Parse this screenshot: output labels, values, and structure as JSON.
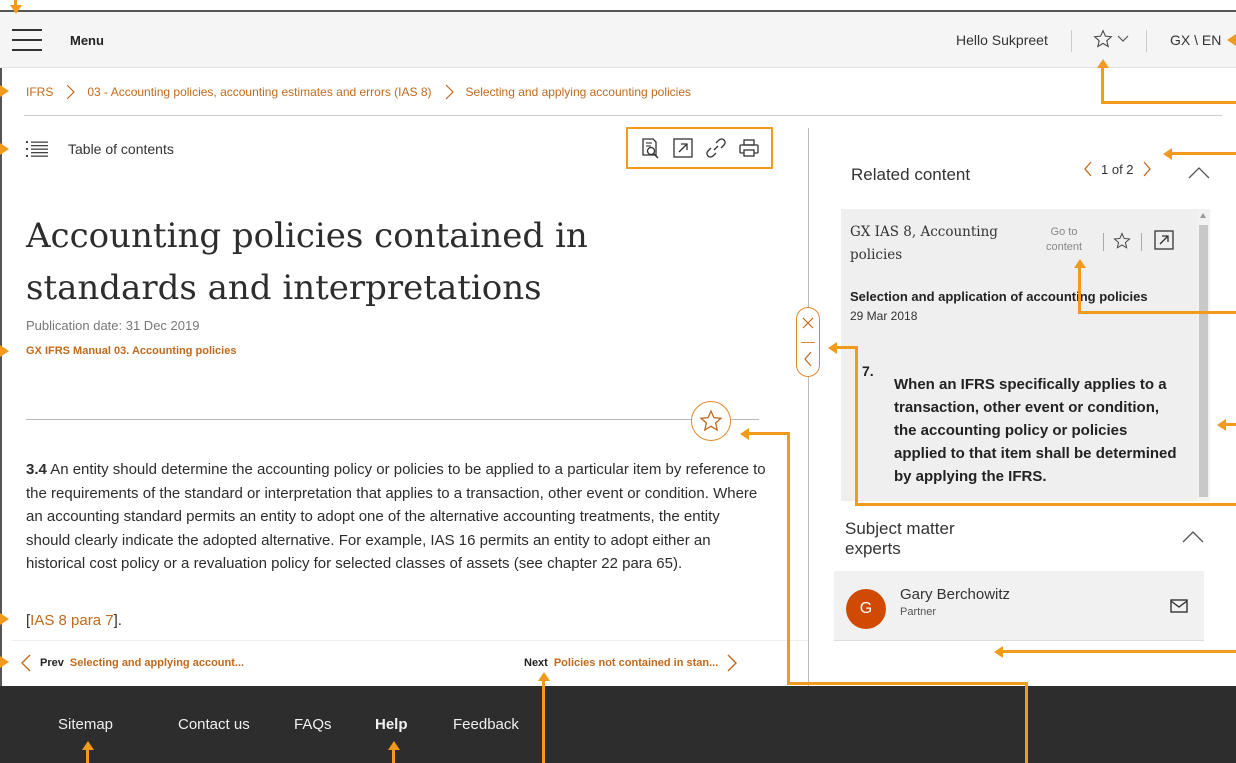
{
  "header": {
    "menu_label": "Menu",
    "greeting": "Hello Sukpreet",
    "language": "GX \\ EN"
  },
  "breadcrumb": [
    "IFRS",
    "03 - Accounting policies, accounting estimates and errors (IAS 8)",
    "Selecting and applying accounting policies"
  ],
  "toc": {
    "label": "Table of contents"
  },
  "toolbar": {
    "icons": [
      "search-document-icon",
      "open-external-icon",
      "link-icon",
      "print-icon"
    ]
  },
  "article": {
    "title": "Accounting policies contained in standards and interpretations",
    "publication_date": "Publication date: 31 Dec 2019",
    "manual_link": "GX IFRS Manual 03. Accounting policies",
    "para_number": "3.4",
    "para_text": "An entity should determine the accounting policy or policies to be applied to a particular item by reference to the requirements of the standard or interpretation that applies to a transaction, other event or condition. Where an accounting standard permits an entity to adopt one of the alternative accounting treatments, the entity should clearly indicate the adopted alternative. For example, IAS 16 permits an entity to adopt either an historical cost policy or a revaluation policy for selected classes of assets (see chapter 22 para 65).",
    "ref_open": "[",
    "ref_link": "IAS 8 para 7",
    "ref_close": "]."
  },
  "pager": {
    "prev_key": "Prev",
    "prev_title": "Selecting and applying account...",
    "next_key": "Next",
    "next_title": "Policies not contained in stan..."
  },
  "related": {
    "title": "Related content",
    "page_indicator": "1 of 2",
    "card": {
      "doc_title": "GX IAS 8, Accounting policies",
      "goto_label": "Go to content",
      "subtitle": "Selection and application of accounting policies",
      "date": "29 Mar 2018",
      "number": "7.",
      "quote": "When an IFRS specifically applies to a transaction, other event or condition, the accounting policy or policies applied to that item shall be determined by applying the IFRS."
    }
  },
  "experts": {
    "title": "Subject matter experts",
    "person": {
      "initial": "G",
      "name": "Gary Berchowitz",
      "role": "Partner"
    }
  },
  "footer": {
    "links": [
      "Sitemap",
      "Contact us",
      "FAQs",
      "Help",
      "Feedback"
    ]
  },
  "colors": {
    "accent": "#c06a1d",
    "annotation": "#f29a1e",
    "avatar": "#d04a02",
    "footer_bg": "#2d2d2d"
  }
}
